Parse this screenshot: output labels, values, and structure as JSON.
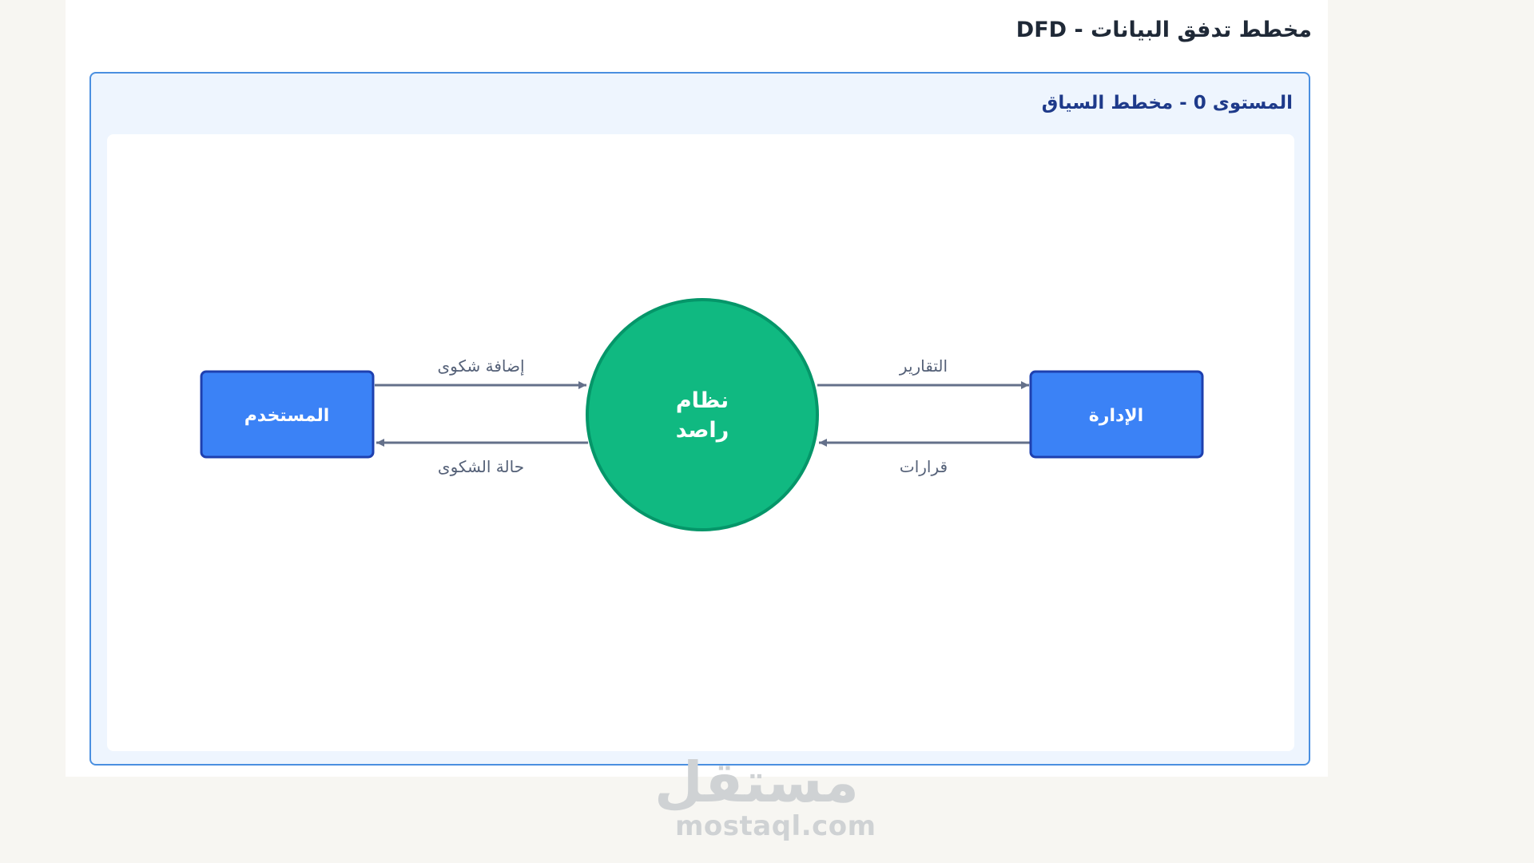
{
  "page": {
    "title": "مخطط تدفق البيانات - DFD"
  },
  "level0": {
    "title": "المستوى 0 - مخطط السياق",
    "nodes": {
      "user": "المستخدم",
      "system_line1": "نظام",
      "system_line2": "راصد",
      "admin": "الإدارة"
    },
    "flows": {
      "add_complaint": "إضافة شكوى",
      "complaint_status": "حالة الشكوى",
      "reports": "التقارير",
      "decisions": "قرارات"
    }
  },
  "colors": {
    "entity_fill": "#3b82f6",
    "entity_border": "#1e40af",
    "process_fill": "#10b981",
    "process_border": "#059669",
    "arrow": "#64708a",
    "card_border": "#4a8fe0"
  },
  "watermark": {
    "arabic": "مستقل",
    "latin": "mostaql.com"
  }
}
